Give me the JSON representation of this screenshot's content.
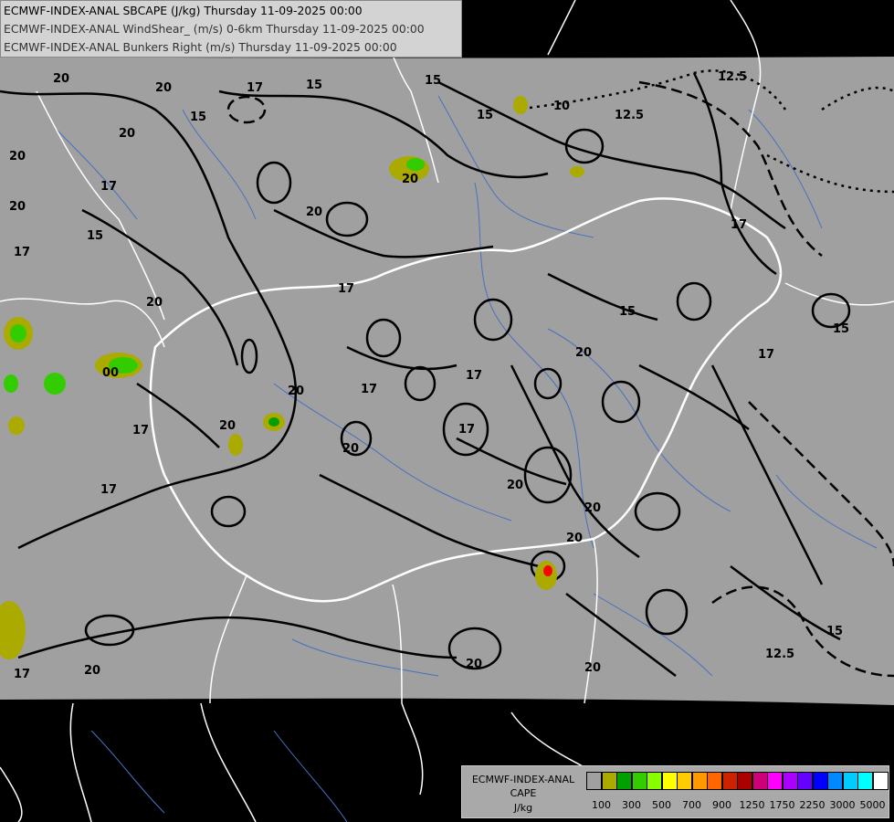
{
  "title_lines": [
    "ECMWF-INDEX-ANAL SBCAPE (J/kg) Thursday 11-09-2025 00:00",
    "ECMWF-INDEX-ANAL WindShear_ (m/s) 0-6km Thursday 11-09-2025 00:00",
    "ECMWF-INDEX-ANAL Bunkers Right (m/s) Thursday 11-09-2025 00:00"
  ],
  "legend": {
    "title": [
      "ECMWF-INDEX-ANAL",
      "CAPE",
      "J/kg"
    ],
    "colors": [
      "#a0a0a0",
      "#aaaa00",
      "#00a000",
      "#33cc00",
      "#88ff00",
      "#ffff00",
      "#ffcc00",
      "#ff9900",
      "#ff6600",
      "#cc2200",
      "#aa0000",
      "#cc0077",
      "#ff00ff",
      "#aa00ff",
      "#6600ff",
      "#0000ff",
      "#0088ff",
      "#00ccff",
      "#00ffff",
      "#ffffff"
    ],
    "ticks": [
      "100",
      "300",
      "500",
      "700",
      "900",
      "1250",
      "1750",
      "2250",
      "3000",
      "5000"
    ]
  },
  "contour_labels": [
    "20",
    "20",
    "15",
    "17",
    "20",
    "20",
    "17",
    "15",
    "17",
    "20",
    "15",
    "15",
    "15",
    "12.5",
    "12.5",
    "10",
    "20",
    "20",
    "20",
    "20",
    "17",
    "17",
    "17",
    "17",
    "20",
    "15",
    "17",
    "15",
    "17",
    "20",
    "20",
    "20",
    "20",
    "20",
    "17",
    "20",
    "20",
    "17",
    "15",
    "12.5",
    "17",
    "20",
    "00"
  ],
  "colors": {
    "map_bg": "#000000",
    "domain_fill": "#a0a0a0",
    "contour": "#000000",
    "border": "#ffffff",
    "river": "#4a70c0"
  }
}
